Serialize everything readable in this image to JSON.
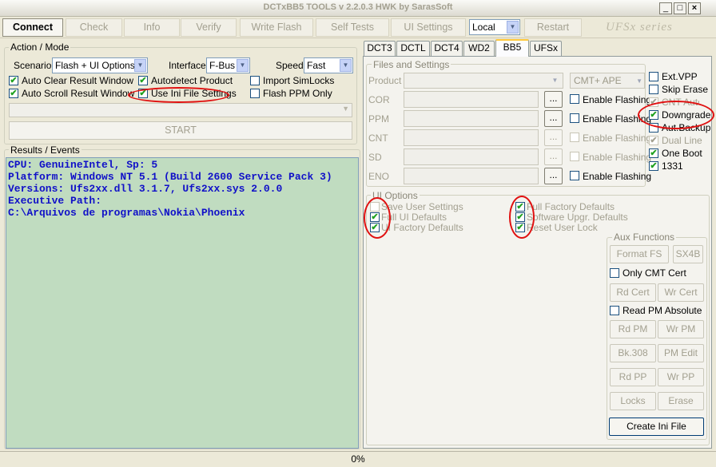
{
  "window": {
    "title": "DCTxBB5 TOOLS v 2.2.0.3 HWK by SarasSoft",
    "min": "_",
    "max": "□",
    "close": "×"
  },
  "toolbar": {
    "buttons": [
      "Connect",
      "Check",
      "Info",
      "Verify",
      "Write Flash",
      "Self Tests",
      "UI Settings"
    ],
    "mode": "Local",
    "restart": "Restart",
    "brand": "UFSx series"
  },
  "action_mode": {
    "title": "Action / Mode",
    "scenario_label": "Scenario",
    "scenario_value": "Flash + UI Options",
    "interface_label": "Interface",
    "interface_value": "F-Bus",
    "speed_label": "Speed",
    "speed_value": "Fast",
    "checks": {
      "auto_clear": "Auto Clear Result Window",
      "auto_scroll": "Auto Scroll Result Window",
      "autodetect": "Autodetect Product",
      "use_ini": "Use Ini File Settings",
      "import_sim": "Import SimLocks",
      "flash_ppm": "Flash PPM Only"
    },
    "start": "START"
  },
  "results": {
    "title": "Results / Events",
    "lines": [
      "CPU: GenuineIntel, Sp: 5",
      "Platform: Windows NT 5.1 (Build 2600 Service Pack 3)",
      "Versions: Ufs2xx.dll 3.1.7, Ufs2xx.sys 2.0.0",
      "Executive Path:",
      "C:\\Arquivos de programas\\Nokia\\Phoenix"
    ]
  },
  "tabs": [
    "DCT3",
    "DCTL",
    "DCT4",
    "WD2",
    "BB5",
    "UFSx"
  ],
  "files": {
    "title": "Files and Settings",
    "product_label": "Product",
    "cmt_value": "CMT+ APE",
    "rows": [
      "COR",
      "PPM",
      "CNT",
      "SD",
      "ENO"
    ],
    "dots": "...",
    "enable_flashing": "Enable Flashing",
    "right_checks": [
      "Ext.VPP",
      "Skip Erase",
      "CNT Auto",
      "Downgrade",
      "Aut.Backup",
      "Dual Line",
      "One Boot",
      "1331"
    ]
  },
  "ui_options": {
    "title": "UI Options",
    "left": [
      "Save User Settings",
      "Full UI Defaults",
      "UI Factory Defaults"
    ],
    "right": [
      "Full Factory Defaults",
      "Software Upgr. Defaults",
      "Reset User Lock"
    ]
  },
  "aux": {
    "title": "Aux Functions",
    "format_fs": "Format FS",
    "sx4b": "SX4B",
    "only_cmt": "Only CMT Cert",
    "rd_cert": "Rd Cert",
    "wr_cert": "Wr Cert",
    "read_pm_abs": "Read PM Absolute",
    "rd_pm": "Rd PM",
    "wr_pm": "Wr PM",
    "bk308": "Bk.308",
    "pm_edit": "PM Edit",
    "rd_pp": "Rd PP",
    "wr_pp": "Wr PP",
    "locks": "Locks",
    "erase": "Erase",
    "create_ini": "Create Ini File"
  },
  "status": {
    "progress_text": "0%",
    "progress": 0
  }
}
